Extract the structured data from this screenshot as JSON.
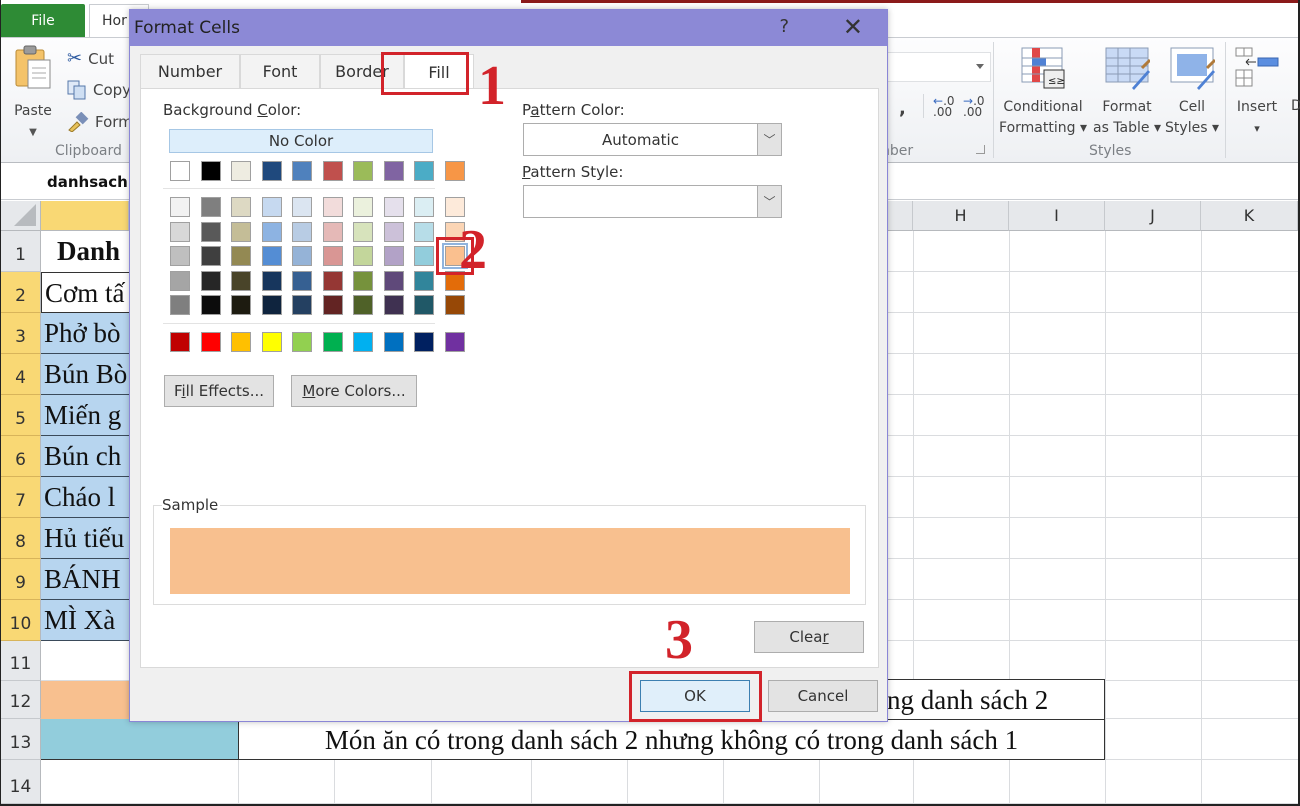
{
  "ribbon": {
    "file_tab": "File",
    "home_tab": "Hor",
    "clipboard": {
      "paste": "Paste",
      "cut": "Cut",
      "copy": "Copy",
      "format_painter": "Form",
      "group_label": "Clipboard"
    },
    "number": {
      "comma": ",",
      "increase_decimal": "←.0 .00",
      "decrease_decimal": "→.0 .00",
      "group_label": "nber"
    },
    "styles": {
      "conditional_formatting_line1": "Conditional",
      "conditional_formatting_line2": "Formatting ▾",
      "format_as_table_line1": "Format",
      "format_as_table_line2": "as Table ▾",
      "cell_styles_line1": "Cell",
      "cell_styles_line2": "Styles ▾",
      "group_label": "Styles"
    },
    "cells": {
      "insert": "Insert",
      "insert_arrow": "▾",
      "delete_partial": "D"
    }
  },
  "name_box": "danhsach",
  "columns": [
    "H",
    "I",
    "J",
    "K"
  ],
  "rows": [
    "1",
    "2",
    "3",
    "4",
    "5",
    "6",
    "7",
    "8",
    "9",
    "10",
    "11",
    "12",
    "13",
    "14"
  ],
  "cells": {
    "a1": "Danh",
    "a2": "Cơm tấ",
    "a3": "Phở bò",
    "a4": "Bún Bò",
    "a5": "Miến g",
    "a6": "Bún ch",
    "a7": "Cháo l",
    "a8": "Hủ tiếu",
    "a9": "BÁNH",
    "a10": "MÌ Xà",
    "legend_row12": "ng danh sách 2",
    "legend_row13": "Món ăn có trong danh sách 2 nhưng không có trong danh sách 1"
  },
  "colors": {
    "selected_fill": "#f8c08f",
    "row12_fill": "#f8c08f",
    "row13_fill": "#92cddc",
    "list_fill": "#b7d5ef",
    "annotation_red": "#d2232a",
    "dialog_title_bg": "#8c89d6"
  },
  "dialog": {
    "title": "Format Cells",
    "help": "?",
    "close": "✕",
    "tabs": [
      "Number",
      "Font",
      "Border",
      "Fill"
    ],
    "active_tab": "Fill",
    "background_color_label": "Background Color:",
    "no_color": "No Color",
    "theme_row": [
      "#ffffff",
      "#000000",
      "#eeece1",
      "#1f497d",
      "#4f81bd",
      "#c0504d",
      "#9bbb59",
      "#8064a2",
      "#4bacc6",
      "#f79646"
    ],
    "shade_rows": [
      [
        "#f2f2f2",
        "#7f7f7f",
        "#ddd9c3",
        "#c6d9f0",
        "#dbe5f1",
        "#f2dcdb",
        "#ebf1dd",
        "#e5e0ec",
        "#dbeef3",
        "#fdeada"
      ],
      [
        "#d8d8d8",
        "#595959",
        "#c4bd97",
        "#8db3e2",
        "#b8cce4",
        "#e5b9b7",
        "#d7e3bc",
        "#ccc1d9",
        "#b7dde8",
        "#fbd5b5"
      ],
      [
        "#bfbfbf",
        "#3f3f3f",
        "#938953",
        "#548dd4",
        "#95b3d7",
        "#d99694",
        "#c3d69b",
        "#b2a2c7",
        "#92cddc",
        "#fac08f"
      ],
      [
        "#a5a5a5",
        "#262626",
        "#494429",
        "#17365d",
        "#366092",
        "#953734",
        "#76923c",
        "#5f497a",
        "#31859b",
        "#e36c09"
      ],
      [
        "#7f7f7f",
        "#0c0c0c",
        "#1d1b10",
        "#0f243e",
        "#244061",
        "#632423",
        "#4f6128",
        "#3f3151",
        "#205867",
        "#974806"
      ]
    ],
    "standard_row": [
      "#c00000",
      "#ff0000",
      "#ffc000",
      "#ffff00",
      "#92d050",
      "#00b050",
      "#00b0f0",
      "#0070c0",
      "#002060",
      "#7030a0"
    ],
    "selected_swatch": {
      "row": 2,
      "col": 9
    },
    "fill_effects": "Fill Effects...",
    "more_colors": "More Colors...",
    "pattern_color_label": "Pattern Color:",
    "pattern_color_value": "Automatic",
    "pattern_style_label": "Pattern Style:",
    "pattern_style_value": "",
    "sample_label": "Sample",
    "clear": "Clear",
    "ok": "OK",
    "cancel": "Cancel"
  },
  "annotations": {
    "step1": "1",
    "step2": "2",
    "step3": "3"
  }
}
